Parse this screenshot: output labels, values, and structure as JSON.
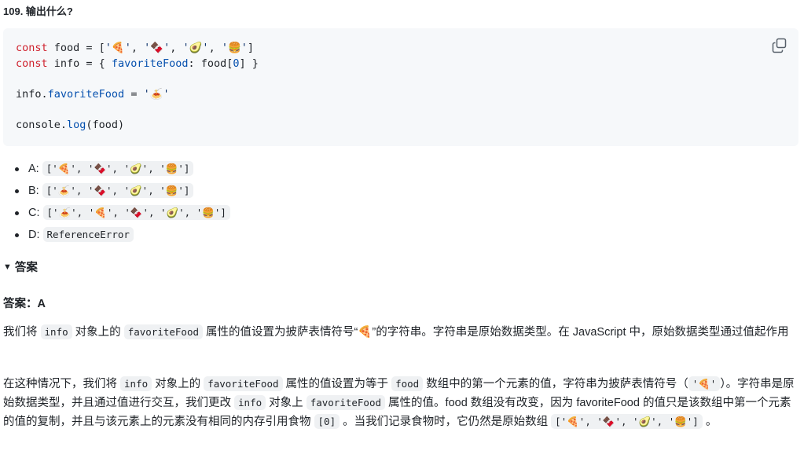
{
  "question": {
    "title": "109. 输出什么?"
  },
  "code": {
    "lines": [
      [
        "kw:const",
        "t: food = [",
        "str:'🍕'",
        "t:, ",
        "str:'🍫'",
        "t:, ",
        "str:'🥑'",
        "t:, ",
        "str:'🍔'",
        "t:]"
      ],
      [
        "kw:const",
        "t: info = { ",
        "prop:favoriteFood",
        "t:: food[",
        "prop:0",
        "t:] }"
      ],
      [],
      [
        "t:info.",
        "prop:favoriteFood",
        "t: = ",
        "str:'🍝'"
      ],
      [],
      [
        "t:console.",
        "prop:log",
        "t:(food)"
      ]
    ],
    "copy_icon": "copy-icon"
  },
  "options": [
    {
      "label": "A:",
      "code": "['🍕', '🍫', '🥑', '🍔']"
    },
    {
      "label": "B:",
      "code": "['🍝', '🍫', '🥑', '🍔']"
    },
    {
      "label": "C:",
      "code": "['🍝', '🍕', '🍫', '🥑', '🍔']"
    },
    {
      "label": "D:",
      "code": "ReferenceError"
    }
  ],
  "details": {
    "summary_icon": "triangle-down-icon",
    "summary_label": "答案"
  },
  "answer": "答案：A",
  "paragraphs": [
    [
      {
        "t": "我们将 "
      },
      {
        "c": "info"
      },
      {
        "t": " 对象上的 "
      },
      {
        "c": "favoriteFood"
      },
      {
        "t": " 属性的值设置为披萨表情符号“🍕”的字符串。字符串是原始数据类型。在 JavaScript 中，原始数据类型通过值起作用"
      }
    ],
    [
      {
        "t": "在这种情况下，我们将 "
      },
      {
        "c": "info"
      },
      {
        "t": " 对象上的 "
      },
      {
        "c": "favoriteFood"
      },
      {
        "t": " 属性的值设置为等于 "
      },
      {
        "c": "food"
      },
      {
        "t": " 数组中的第一个元素的值，字符串为披萨表情符号（"
      },
      {
        "c": "'🍕'"
      },
      {
        "t": "）。字符串是原始数据类型，并且通过值进行交互，我们更改 "
      },
      {
        "c": "info"
      },
      {
        "t": " 对象上 "
      },
      {
        "c": "favoriteFood"
      },
      {
        "t": " 属性的值。food 数组没有改变，因为 favoriteFood 的值只是该数组中第一个元素的值的复制，并且与该元素上的元素没有相同的内存引用食物 "
      },
      {
        "c": "[0]"
      },
      {
        "t": " 。当我们记录食物时，它仍然是原始数组 "
      },
      {
        "c": "['🍕', '🍫', '🥑', '🍔']"
      },
      {
        "t": " 。"
      }
    ]
  ]
}
